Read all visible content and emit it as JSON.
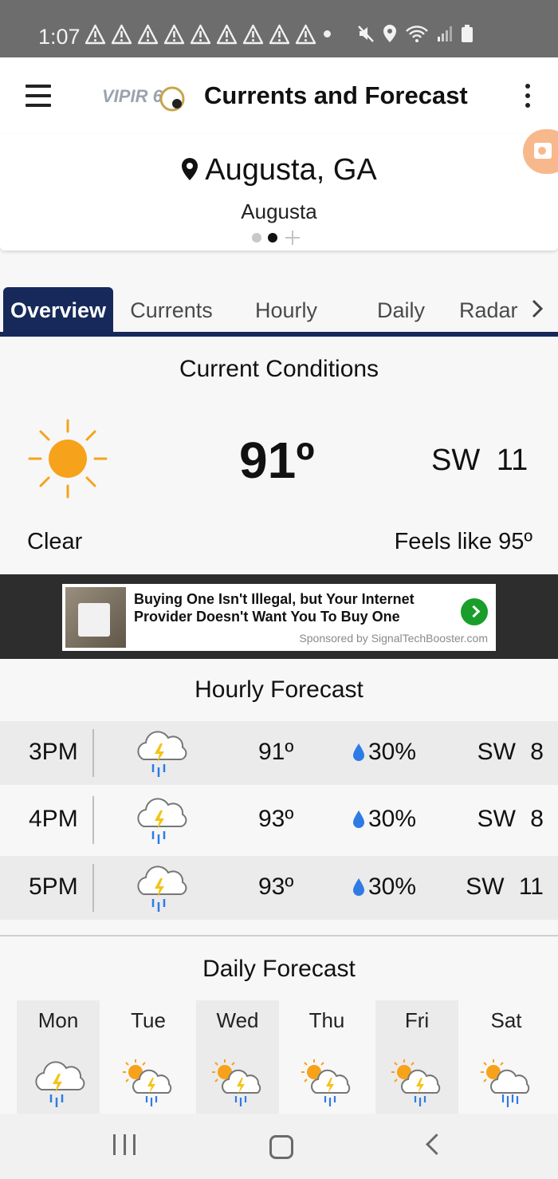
{
  "status_bar": {
    "time": "1:07"
  },
  "app_bar": {
    "title": "Currents and Forecast",
    "logo_text": "VIPIR 6"
  },
  "location": {
    "name": "Augusta, GA",
    "sub_name": "Augusta"
  },
  "tabs": [
    {
      "label": "Overview",
      "active": true
    },
    {
      "label": "Currents",
      "active": false
    },
    {
      "label": "Hourly",
      "active": false
    },
    {
      "label": "Daily",
      "active": false
    },
    {
      "label": "Radar",
      "active": false
    }
  ],
  "current": {
    "section_title": "Current Conditions",
    "icon": "sun-icon",
    "temp": "91º",
    "wind": "SW 11",
    "condition": "Clear",
    "feels_like": "Feels like 95º"
  },
  "ad": {
    "headline": "Buying One Isn't Illegal, but Your Internet Provider Doesn't Want You To Buy One",
    "sponsor": "Sponsored by SignalTechBooster.com"
  },
  "hourly": {
    "section_title": "Hourly Forecast",
    "rows": [
      {
        "time": "3PM",
        "icon": "thunderstorm-icon",
        "temp": "91º",
        "precip": "30%",
        "wind": "SW 8"
      },
      {
        "time": "4PM",
        "icon": "thunderstorm-icon",
        "temp": "93º",
        "precip": "30%",
        "wind": "SW 8"
      },
      {
        "time": "5PM",
        "icon": "thunderstorm-icon",
        "temp": "93º",
        "precip": "30%",
        "wind": "SW 11"
      }
    ]
  },
  "daily": {
    "section_title": "Daily Forecast",
    "days": [
      {
        "name": "Mon",
        "icon": "thunderstorm-icon"
      },
      {
        "name": "Tue",
        "icon": "partly-sunny-storm-icon"
      },
      {
        "name": "Wed",
        "icon": "partly-sunny-storm-icon"
      },
      {
        "name": "Thu",
        "icon": "partly-sunny-storm-icon"
      },
      {
        "name": "Fri",
        "icon": "partly-sunny-storm-icon"
      },
      {
        "name": "Sat",
        "icon": "partly-sunny-rain-icon"
      }
    ]
  },
  "colors": {
    "accent": "#16295a",
    "sun": "#f7a21b",
    "rain": "#2e7be6",
    "status_bar": "#6d6d6d"
  }
}
